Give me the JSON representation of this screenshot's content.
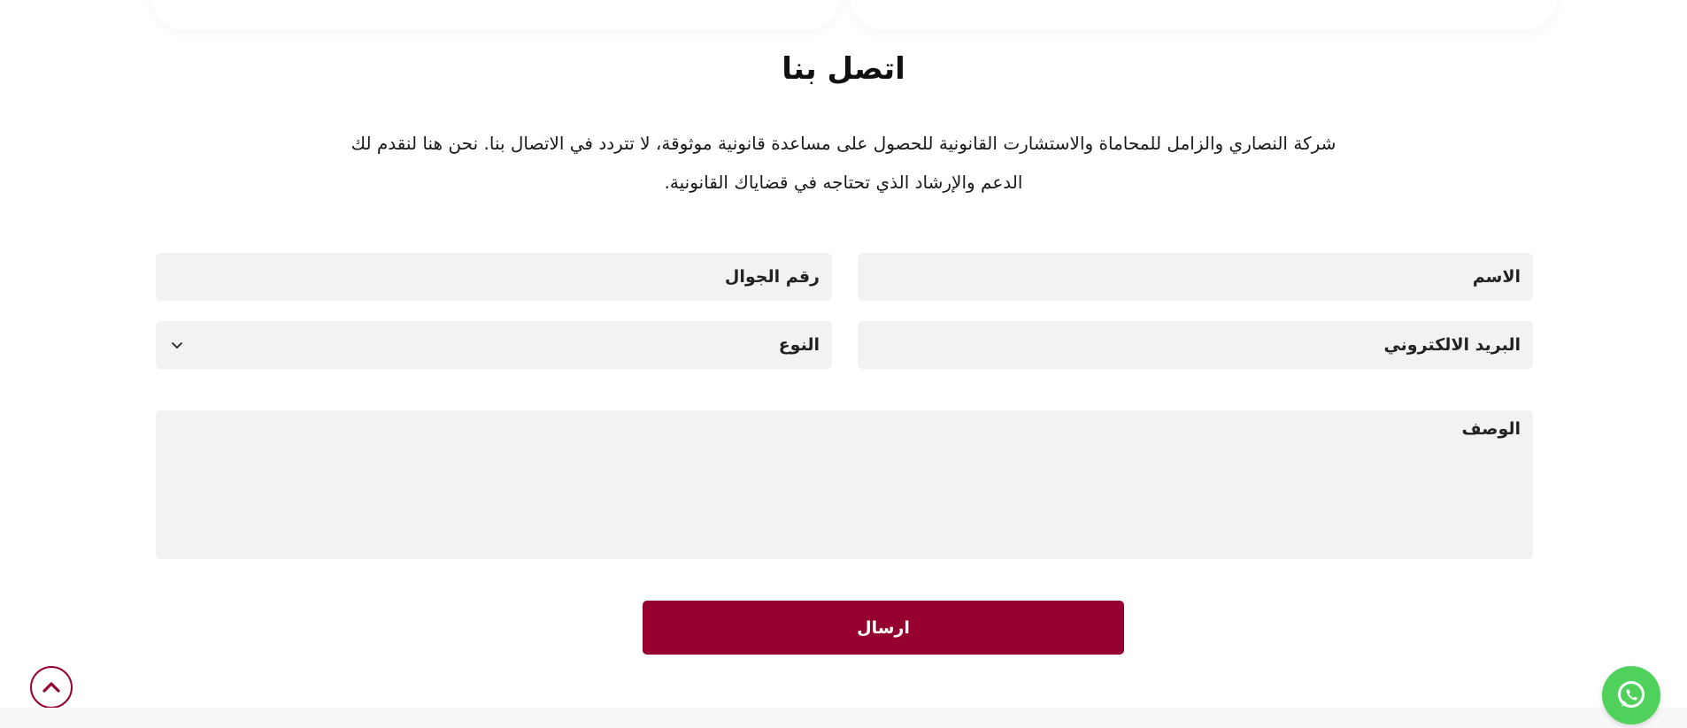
{
  "section": {
    "title": "اتصل بنا",
    "description_line1": "شركة النصاري والزامل للمحاماة والاستشارت القانونية للحصول على مساعدة قانونية موثوقة، لا تتردد في الاتصال بنا. نحن هنا لنقدم لك",
    "description_line2": "الدعم والإرشاد الذي تحتاجه في قضاياك القانونية."
  },
  "form": {
    "name_placeholder": "الاسم",
    "mobile_placeholder": "رقم الجوال",
    "email_placeholder": "البريد الالكتروني",
    "type_selected": "النوع",
    "description_placeholder": "الوصف",
    "submit_label": "ارسال"
  },
  "colors": {
    "brand": "#960030",
    "field_bg": "#f2f2f2",
    "whatsapp": "#4fd15b"
  },
  "icons": {
    "type_dropdown": "chevron-down-icon",
    "scroll_top": "chevron-up-icon",
    "whatsapp": "whatsapp-icon"
  }
}
